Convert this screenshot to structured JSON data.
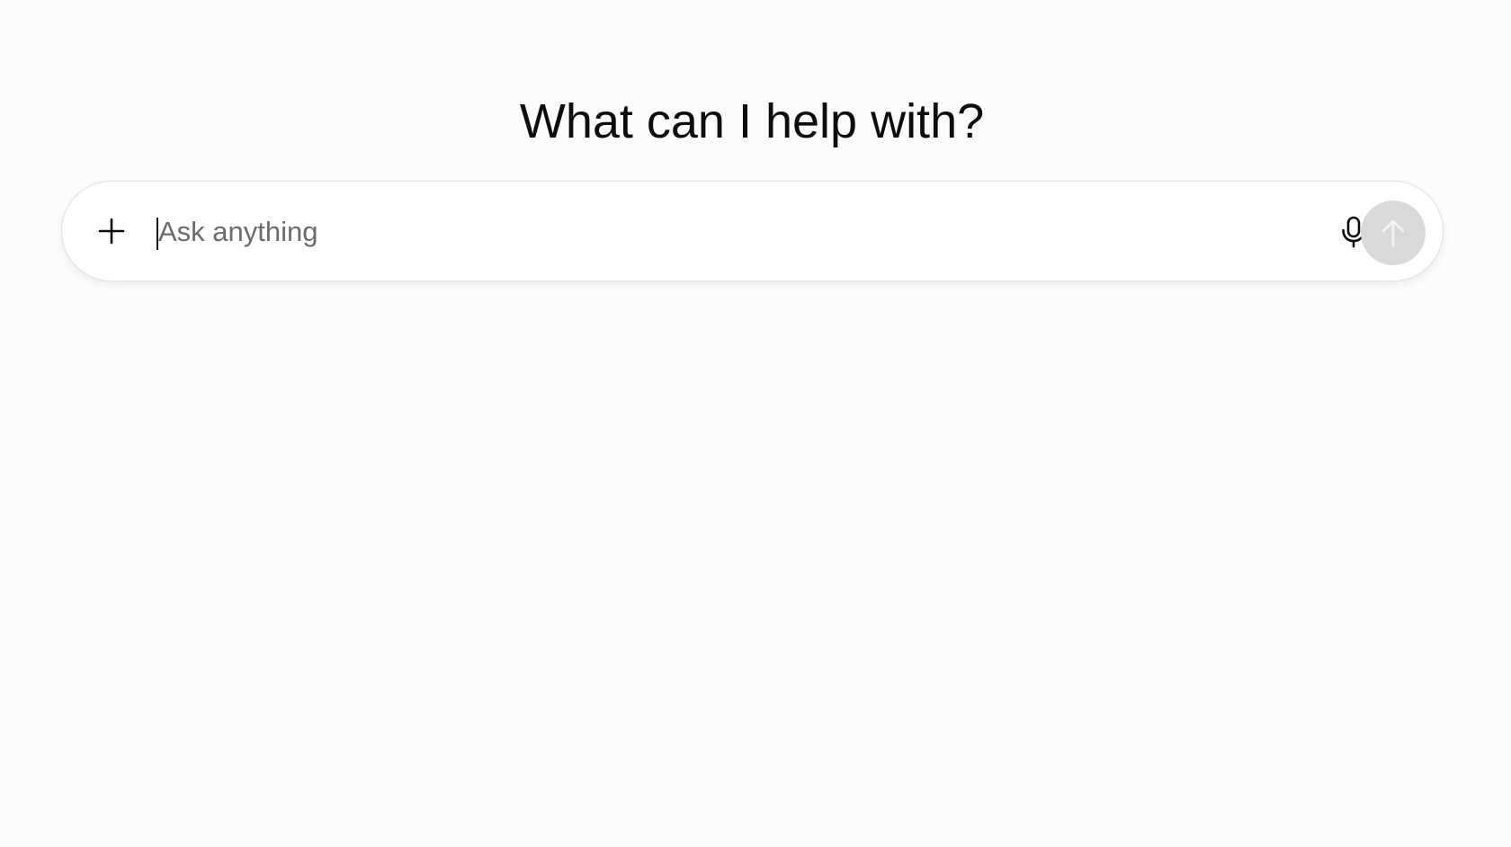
{
  "main": {
    "heading": "What can I help with?"
  },
  "composer": {
    "placeholder": "Ask anything",
    "value": "",
    "icons": {
      "attach": "plus-icon",
      "voice": "microphone-icon",
      "send": "arrow-up-icon"
    },
    "send_enabled": false
  },
  "colors": {
    "background": "#fcfcfc",
    "text": "#0d0d0d",
    "placeholder": "#6b6b6b",
    "send_disabled": "#d9d9d9"
  }
}
